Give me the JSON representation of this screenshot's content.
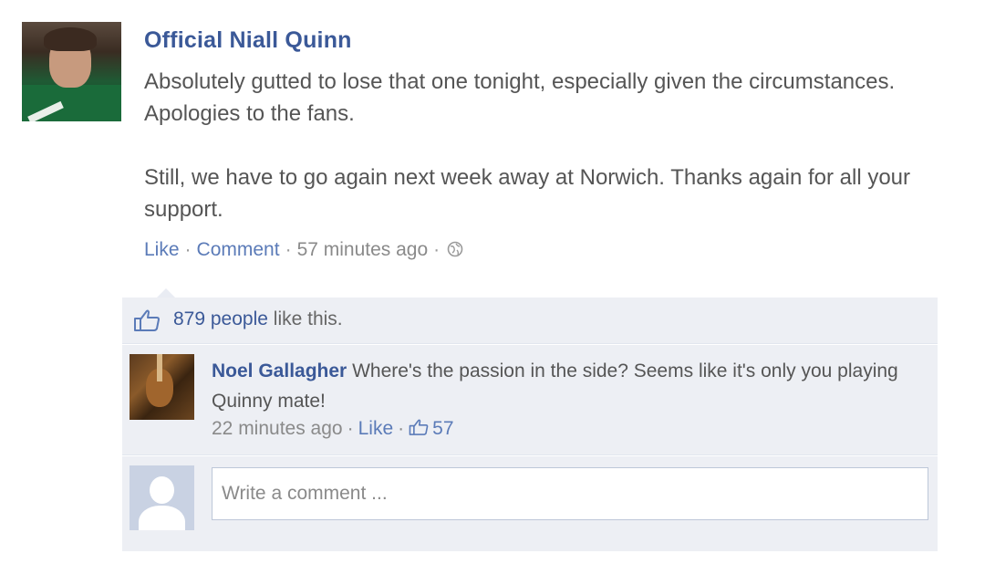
{
  "post": {
    "author": "Official Niall Quinn",
    "paragraph1": "Absolutely gutted to lose that one tonight, especially given the circumstances. Apologies to the fans.",
    "paragraph2": "Still, we have to go again next week away at Norwich. Thanks again for all your support.",
    "like_label": "Like",
    "comment_label": "Comment",
    "timestamp": "57 minutes ago",
    "privacy_icon": "globe-icon"
  },
  "likes": {
    "count_text": "879 people",
    "suffix": "like this."
  },
  "comment": {
    "author": "Noel Gallagher",
    "text": "Where's the passion in the side? Seems like it's only you playing Quinny mate!",
    "timestamp": "22 minutes ago",
    "like_label": "Like",
    "like_count": "57"
  },
  "composer": {
    "placeholder": "Write a comment ..."
  },
  "colors": {
    "link": "#3b5998",
    "feedback_bg": "#edeff4"
  }
}
